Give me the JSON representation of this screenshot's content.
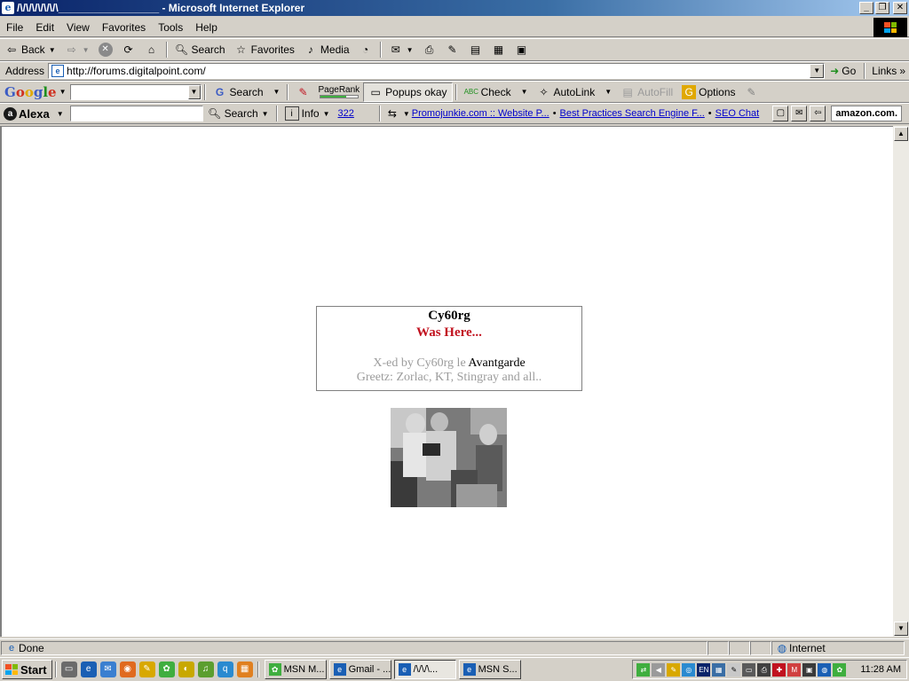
{
  "window": {
    "title": "/\\/\\/\\/\\/\\/\\/\\_________________ - Microsoft Internet Explorer",
    "controls": {
      "minimize": "_",
      "restore": "❐",
      "close": "✕"
    }
  },
  "menu": [
    "File",
    "Edit",
    "View",
    "Favorites",
    "Tools",
    "Help"
  ],
  "toolbar": {
    "back": "Back",
    "search": "Search",
    "favorites": "Favorites",
    "media": "Media"
  },
  "address": {
    "label": "Address",
    "url": "http://forums.digitalpoint.com/",
    "go": "Go",
    "links": "Links"
  },
  "google_toolbar": {
    "logo": [
      "G",
      "o",
      "o",
      "g",
      "l",
      "e"
    ],
    "search": "Search",
    "pagerank_label": "PageRank",
    "pagerank_level": 0.7,
    "popups": "Popups okay",
    "check": "Check",
    "autolink": "AutoLink",
    "autofill": "AutoFill",
    "options": "Options"
  },
  "alexa_toolbar": {
    "logo": "Alexa",
    "search": "Search",
    "info": "Info",
    "count": "322",
    "links": [
      "Promojunkie.com :: Website P...",
      "Best Practices Search Engine F...",
      "SEO Chat"
    ],
    "amazon": "amazon.com."
  },
  "page": {
    "title": "Cy60rg",
    "subtitle": "Was Here...",
    "credit_prefix": "X-ed by Cy60rg le",
    "credit_name": "Avantgarde",
    "greetz": "Greetz: Zorlac, KT, Stingray and all.."
  },
  "status": {
    "text": "Done",
    "zone": "Internet"
  },
  "taskbar": {
    "start": "Start",
    "tasks": [
      "MSN M...",
      "Gmail - ...",
      "/\\/\\/\\...",
      "MSN S..."
    ],
    "tray_lang": "EN",
    "clock": "11:28 AM"
  },
  "colors": {
    "title_gradient_start": "#0a246a",
    "title_gradient_end": "#a6caf0",
    "chrome": "#d4d0c8",
    "accent_red": "#c1121f",
    "link_blue": "#0000cc"
  }
}
